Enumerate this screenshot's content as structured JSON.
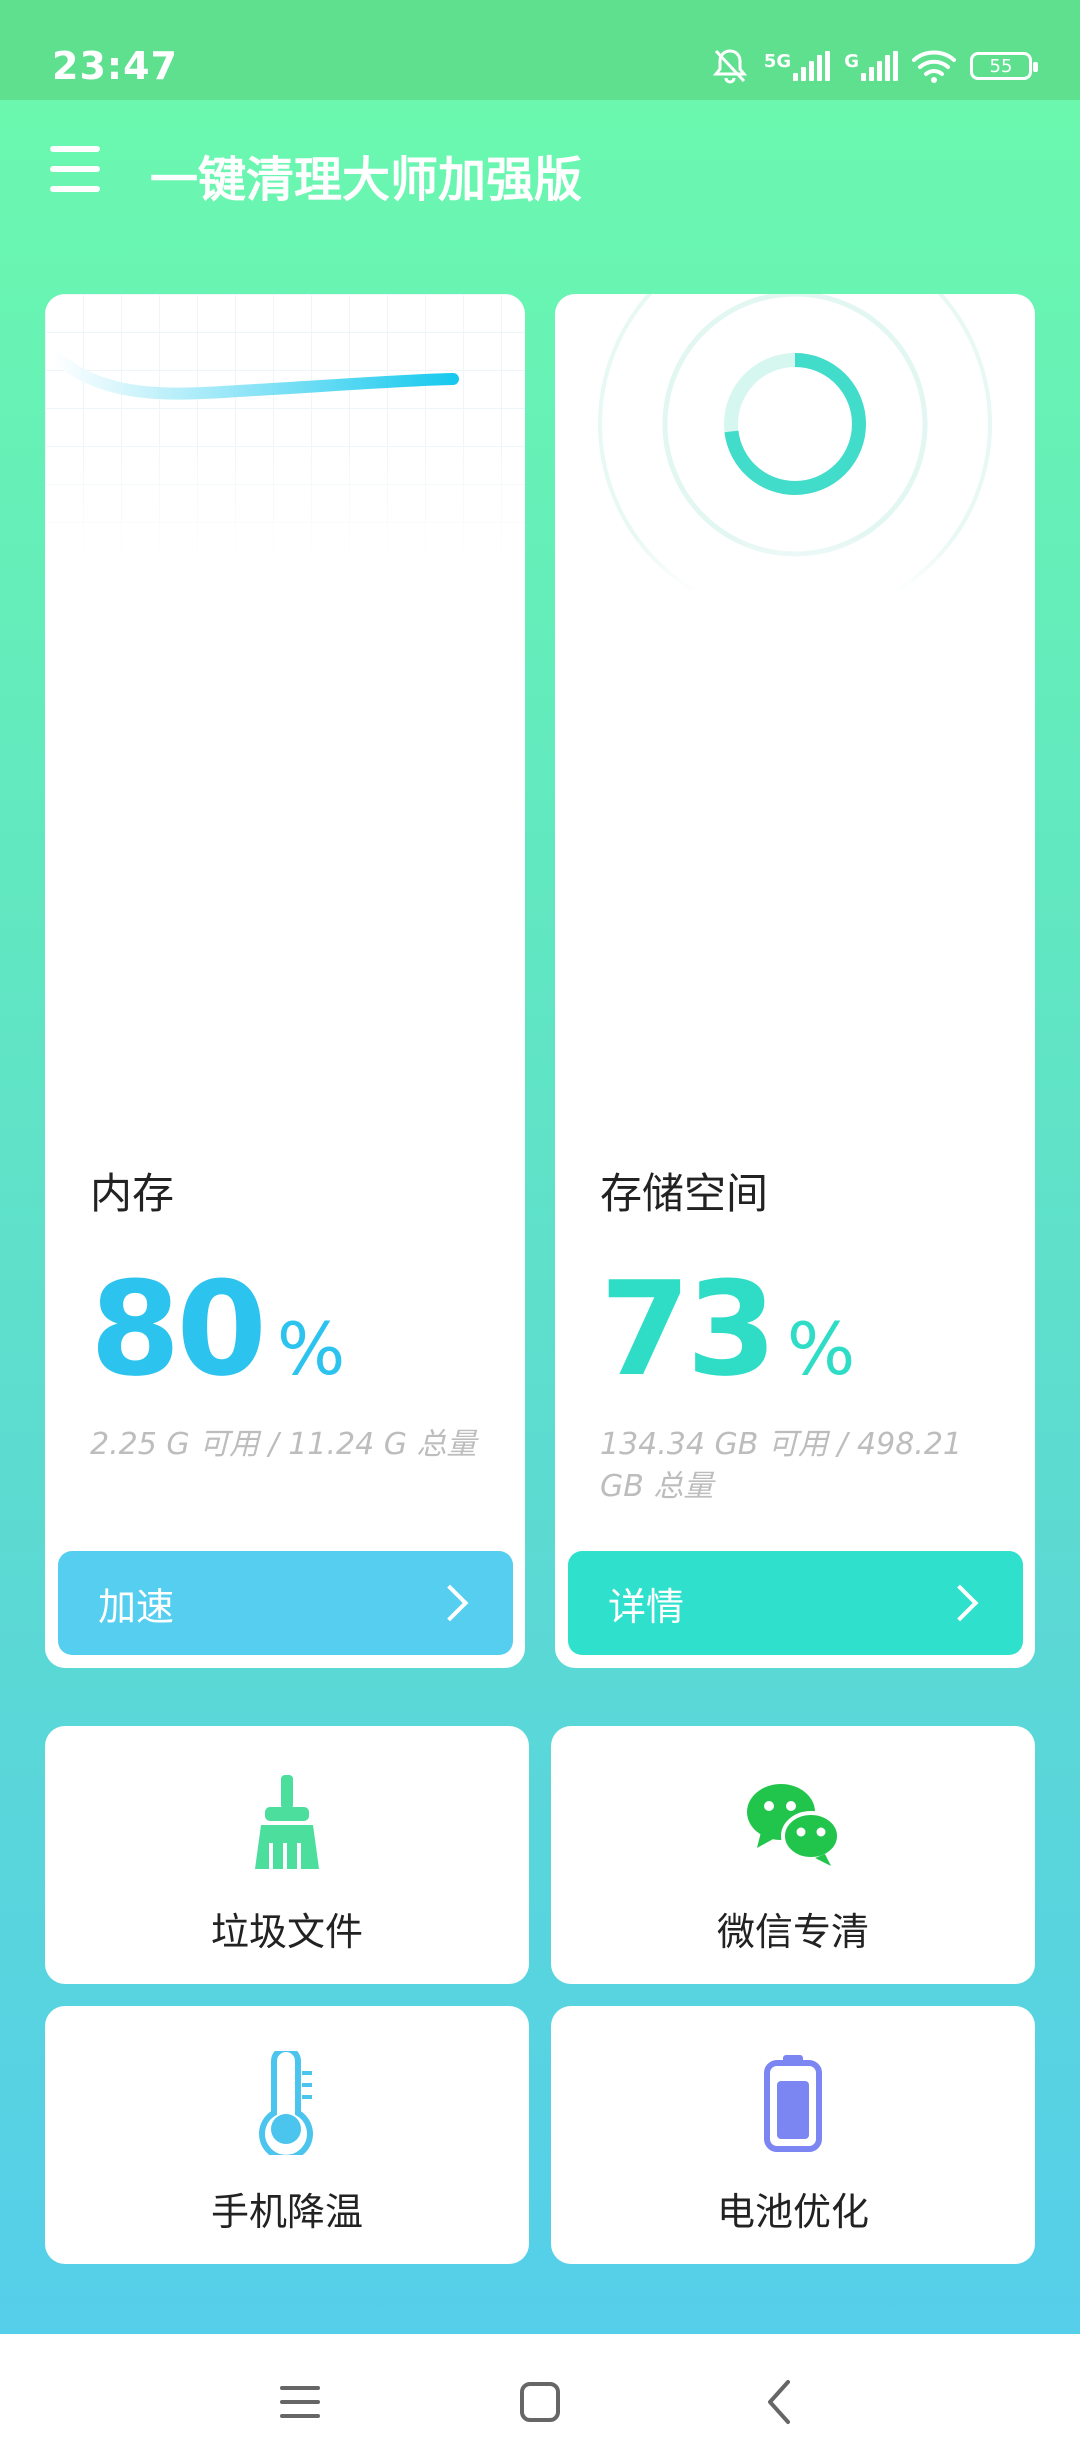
{
  "status_bar": {
    "time": "23:47",
    "network_1": "5G",
    "network_2": "G",
    "battery_level": "55",
    "icons": [
      "bell-mute-icon",
      "signal-icon",
      "signal-icon",
      "wifi-icon",
      "battery-icon"
    ]
  },
  "app_bar": {
    "title": "一键清理大师加强版",
    "menu_icon": "hamburger-menu-icon"
  },
  "memory_card": {
    "label": "内存",
    "percent": "80",
    "percent_sign": "%",
    "detail": "2.25 G 可用 / 11.24 G 总量",
    "button_label": "加速",
    "accent_color": "#2CC3EE",
    "button_color": "#55CEEF"
  },
  "storage_card": {
    "label": "存储空间",
    "percent": "73",
    "percent_sign": "%",
    "detail": " 134.34 GB  可用 / 498.21 GB  总量",
    "button_label": "详情",
    "accent_color": "#2FDDC6",
    "button_color": "#2FE1CD"
  },
  "tiles": [
    {
      "label": "垃圾文件",
      "icon": "broom-icon",
      "color": "#4BDE9C"
    },
    {
      "label": "微信专清",
      "icon": "wechat-icon",
      "color": "#22C54B"
    },
    {
      "label": "手机降温",
      "icon": "thermometer-icon",
      "color": "#4BC4EE"
    },
    {
      "label": "电池优化",
      "icon": "battery-icon",
      "color": "#7C86F2"
    }
  ],
  "nav_bar": {
    "icons": [
      "recent-apps-icon",
      "home-icon",
      "back-icon"
    ]
  }
}
